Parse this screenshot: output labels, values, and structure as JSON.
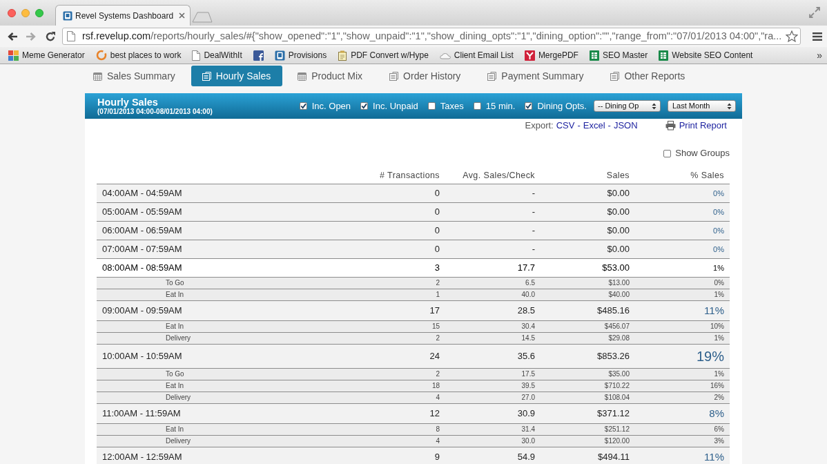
{
  "browser": {
    "tab": {
      "title": "Revel Systems Dashboard"
    },
    "address": {
      "host": "rsf.revelup.com",
      "path": "/reports/hourly_sales/#{\"show_opened\":\"1\",\"show_unpaid\":\"1\",\"show_dining_opts\":\"1\",\"dining_option\":\"\",\"range_from\":\"07/01/2013 04:00\",\"ra..."
    },
    "bookmarks": [
      {
        "label": "Meme Generator",
        "kind": "mosaic"
      },
      {
        "label": "best places to work",
        "kind": "ring"
      },
      {
        "label": "DealWithIt",
        "kind": "page"
      },
      {
        "kind": "social"
      },
      {
        "label": "Provisions",
        "kind": "tablet"
      },
      {
        "label": "PDF Convert w/Hype",
        "kind": "clipboard"
      },
      {
        "label": "Client Email List",
        "kind": "cloud"
      },
      {
        "label": "MergePDF",
        "kind": "ribbon"
      },
      {
        "label": "SEO Master",
        "kind": "sheet"
      },
      {
        "label": "Website SEO Content",
        "kind": "sheet"
      }
    ],
    "overflow": "»"
  },
  "nav_tabs": [
    {
      "label": "Sales Summary",
      "kind": "calendar",
      "selected": false
    },
    {
      "label": "Hourly Sales",
      "kind": "pages",
      "selected": true
    },
    {
      "label": "Product Mix",
      "kind": "calendar",
      "selected": false
    },
    {
      "label": "Order History",
      "kind": "pages",
      "selected": false
    },
    {
      "label": "Payment Summary",
      "kind": "pages",
      "selected": false
    },
    {
      "label": "Other Reports",
      "kind": "pages",
      "selected": false
    }
  ],
  "report": {
    "title": "Hourly Sales",
    "range": "(07/01/2013 04:00-08/01/2013 04:00)",
    "options": [
      {
        "label": "Inc. Open",
        "checked": true
      },
      {
        "label": "Inc. Unpaid",
        "checked": true
      },
      {
        "label": "Taxes",
        "checked": false
      },
      {
        "label": "15 min.",
        "checked": false
      },
      {
        "label": "Dining Opts.",
        "checked": true
      }
    ],
    "selects": [
      {
        "value": "-- Dining Op"
      },
      {
        "value": "Last Month"
      }
    ],
    "export": {
      "label": "Export:",
      "links": [
        "CSV",
        "Excel",
        "JSON"
      ],
      "separator": "-"
    },
    "print": "Print Report",
    "show_groups": {
      "label": "Show Groups",
      "checked": false
    }
  },
  "table": {
    "columns": [
      "# Transactions",
      "Avg. Sales/Check",
      "Sales",
      "% Sales"
    ],
    "rows": [
      {
        "label": "04:00AM - 04:59AM",
        "cells": [
          "0",
          "-",
          "$0.00",
          "0%"
        ],
        "kind": "small",
        "hovered": false
      },
      {
        "label": "05:00AM - 05:59AM",
        "cells": [
          "0",
          "-",
          "$0.00",
          "0%"
        ],
        "kind": "small",
        "hovered": false
      },
      {
        "label": "06:00AM - 06:59AM",
        "cells": [
          "0",
          "-",
          "$0.00",
          "0%"
        ],
        "kind": "small",
        "hovered": false
      },
      {
        "label": "07:00AM - 07:59AM",
        "cells": [
          "0",
          "-",
          "$0.00",
          "0%"
        ],
        "kind": "small",
        "hovered": false
      },
      {
        "label": "08:00AM - 08:59AM",
        "cells": [
          "3",
          "17.7",
          "$53.00",
          "1%"
        ],
        "kind": "small",
        "hovered": true,
        "children": [
          {
            "label": "To Go",
            "cells": [
              "2",
              "6.5",
              "$13.00",
              "0%"
            ]
          },
          {
            "label": "Eat In",
            "cells": [
              "1",
              "40.0",
              "$40.00",
              "1%"
            ]
          }
        ]
      },
      {
        "label": "09:00AM - 09:59AM",
        "cells": [
          "17",
          "28.5",
          "$485.16",
          "11%"
        ],
        "kind": "medium",
        "hovered": false,
        "children": [
          {
            "label": "Eat In",
            "cells": [
              "15",
              "30.4",
              "$456.07",
              "10%"
            ]
          },
          {
            "label": "Delivery",
            "cells": [
              "2",
              "14.5",
              "$29.08",
              "1%"
            ]
          }
        ]
      },
      {
        "label": "10:00AM - 10:59AM",
        "cells": [
          "24",
          "35.6",
          "$853.26",
          "19%"
        ],
        "kind": "large",
        "hovered": false,
        "children": [
          {
            "label": "To Go",
            "cells": [
              "2",
              "17.5",
              "$35.00",
              "1%"
            ]
          },
          {
            "label": "Eat In",
            "cells": [
              "18",
              "39.5",
              "$710.22",
              "16%"
            ]
          },
          {
            "label": "Delivery",
            "cells": [
              "4",
              "27.0",
              "$108.04",
              "2%"
            ]
          }
        ]
      },
      {
        "label": "11:00AM - 11:59AM",
        "cells": [
          "12",
          "30.9",
          "$371.12",
          "8%"
        ],
        "kind": "medium",
        "hovered": false,
        "children": [
          {
            "label": "Eat In",
            "cells": [
              "8",
              "31.4",
              "$251.12",
              "6%"
            ]
          },
          {
            "label": "Delivery",
            "cells": [
              "4",
              "30.0",
              "$120.00",
              "3%"
            ]
          }
        ]
      },
      {
        "label": "12:00AM - 12:59AM",
        "cells": [
          "9",
          "54.9",
          "$494.11",
          "11%"
        ],
        "kind": "medium",
        "hovered": false
      }
    ]
  }
}
